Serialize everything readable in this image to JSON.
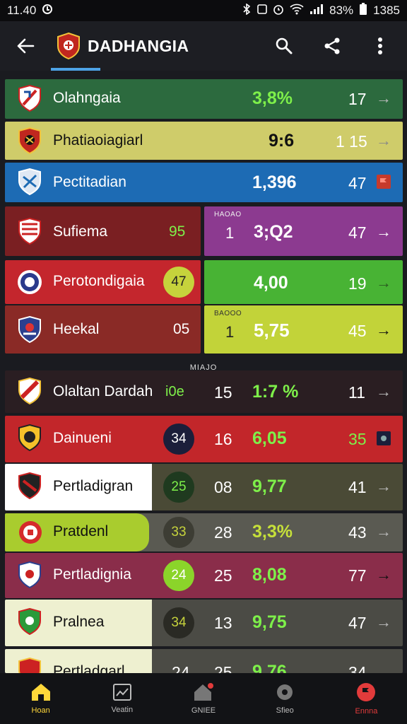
{
  "status": {
    "time": "11.40",
    "battery": "83%",
    "clock_right": "1385"
  },
  "app": {
    "title": "DADHANGIA"
  },
  "sections": {
    "mid_label": "MIAJO"
  },
  "rows": [
    {
      "name": "Olahngaia",
      "pct": "3,8%",
      "num": "17"
    },
    {
      "name": "Phatiaoiagiarl",
      "pct": "9:6",
      "num": "1 15"
    },
    {
      "name": "Pectitadian",
      "pct": "1,396",
      "num": "47"
    },
    {
      "name": "Sufiema",
      "score": "95",
      "tag": "HAOAO",
      "idx": "1",
      "pct": "3;Q2",
      "num": "47"
    },
    {
      "name": "Perotondigaia",
      "score": "47",
      "pct": "4,00",
      "num": "19"
    },
    {
      "name": "Heekal",
      "score": "05",
      "tag": "BAOOO",
      "idx": "1",
      "pct": "5,75",
      "num": "45"
    },
    {
      "name": "Olaltan Dardah",
      "score": "i0e",
      "idx": "15",
      "pct": "1:7 %",
      "num": "11"
    },
    {
      "name": "Dainueni",
      "score": "34",
      "idx": "16",
      "pct": "6,05",
      "num": "35"
    },
    {
      "name": "Pertladigran",
      "score": "25",
      "idx": "08",
      "pct": "9,77",
      "num": "41"
    },
    {
      "name": "Pratdenl",
      "score": "33",
      "idx": "28",
      "pct": "3,3%",
      "num": "43"
    },
    {
      "name": "Pertladignia",
      "score": "24",
      "idx": "25",
      "pct": "8,08",
      "num": "77"
    },
    {
      "name": "Pralnea",
      "score": "34",
      "idx": "13",
      "pct": "9,75",
      "num": "47"
    },
    {
      "name": "Pertladgarl",
      "score": "24",
      "idx": "25",
      "pct": "9,76",
      "num": "34"
    }
  ],
  "nav": [
    {
      "label": "Hoan"
    },
    {
      "label": "Veatin"
    },
    {
      "label": "GNIEE"
    },
    {
      "label": "Sfieo"
    },
    {
      "label": "Ennna"
    }
  ],
  "colors": {
    "green_text": "#7ef04a",
    "accent_blue": "#4da3e6",
    "nav_active": "#ffd83a"
  }
}
